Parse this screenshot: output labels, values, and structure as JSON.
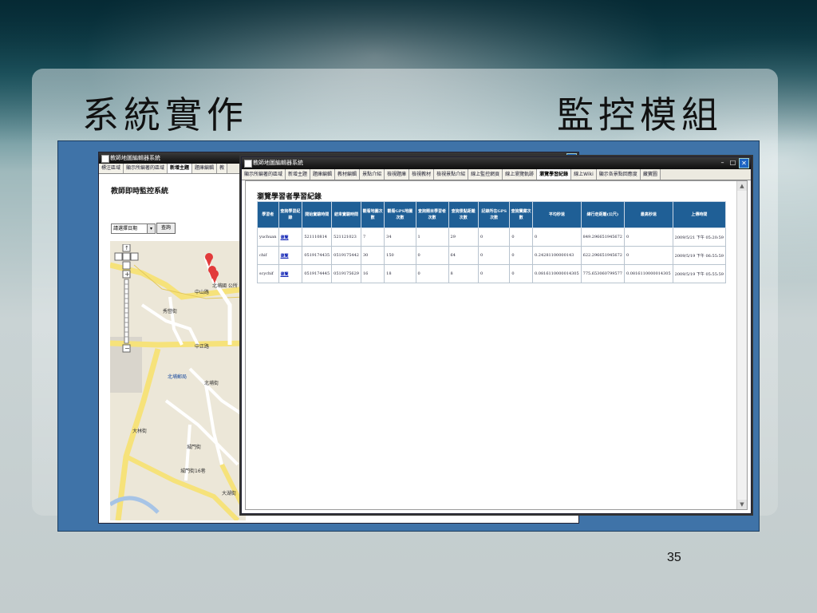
{
  "slide": {
    "title_left": "系統實作",
    "title_right": "監控模組",
    "page_number": "35"
  },
  "back_window": {
    "title": "教師地圖編輯器系統",
    "tabs": [
      "標注區域",
      "顯示所編著的區域",
      "新增主題",
      "題庫編輯",
      "教"
    ],
    "active_tab": 2,
    "heading": "教師即時監控系統",
    "date_select_value": "請選擇日期",
    "query_button": "查詢",
    "map_labels": [
      "中山路",
      "中正路",
      "北埔郵局",
      "北埔國 公所",
      "北埔街",
      "大林街",
      "城門街",
      "城門街16巷",
      "大湖街",
      "秀巒街"
    ]
  },
  "front_window": {
    "title": "教師地圖編輯器系統",
    "tabs": [
      "顯示所編著的區域",
      "新增主題",
      "題庫編輯",
      "教材編輯",
      "景點介紹",
      "檢視題庫",
      "檢視教材",
      "檢視景點介紹",
      "線上監控網頁",
      "線上瀏覽軌跡",
      "瀏覽學習紀錄",
      "線上Wiki",
      "顯示各景點回應度",
      "藏寶圖"
    ],
    "active_tab": 10,
    "table_title": "瀏覽學習者學習紀錄",
    "columns": [
      "學習者",
      "查詢學習紀錄",
      "開始實驗時間",
      "結束實驗時間",
      "觀看地圖次數",
      "觀看GPS地圖次數",
      "查詢題目學習者次數",
      "查詢景點距離次數",
      "記錄所在GPS次數",
      "查詢寶藏次數",
      "平均秒速",
      "總行走距離(公尺)",
      "最高秒速",
      "上傳時間"
    ],
    "rows": [
      [
        "yuchuan",
        "瀏覽",
        "521110814",
        "521121023",
        "7",
        "34",
        "1",
        "29",
        "0",
        "0",
        "0",
        "849.296651945672",
        "0",
        "2009/5/21 下午 05:20:59"
      ],
      [
        "chif",
        "瀏覽",
        "0519174435",
        "0519175442",
        "30",
        "150",
        "0",
        "64",
        "0",
        "0",
        "0.24281100000143",
        "622.296651945672",
        "0",
        "2009/5/19 下午 06:55:59"
      ],
      [
        "scychif",
        "瀏覽",
        "0519174445",
        "0519175629",
        "16",
        "18",
        "0",
        "8",
        "0",
        "0",
        "0.0816110000014305",
        "775.653060799577",
        "0.0816110000014305",
        "2009/5/19 下午 05:55:59"
      ]
    ]
  },
  "colors": {
    "header_blue": "#1f5f96",
    "title_bar": "#111111",
    "map_road": "#f6e27a"
  }
}
